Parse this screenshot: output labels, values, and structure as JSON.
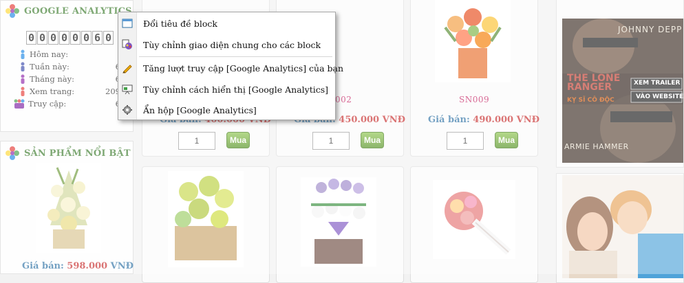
{
  "analytics": {
    "title": "GOOGLE ANALYTICS",
    "counter": [
      "0",
      "0",
      "0",
      "0",
      "0",
      "0",
      "6",
      "0"
    ],
    "stats": [
      {
        "label": "Hôm nay:",
        "value": ""
      },
      {
        "label": "Tuần này:",
        "value": "6"
      },
      {
        "label": "Tháng này:",
        "value": "6"
      },
      {
        "label": "Xem trang:",
        "value": "209"
      },
      {
        "label": "Truy cập:",
        "value": "6"
      }
    ]
  },
  "featured": {
    "title": "SẢN PHẨM NỔI BẬT",
    "price_label": "Giá bán:",
    "price": "598.000",
    "currency": "VNĐ"
  },
  "products_top": [
    {
      "code": "",
      "price_label": "Giá bán:",
      "price": "400.000 VNĐ",
      "qty": "1",
      "buy": "Mua"
    },
    {
      "code": "002",
      "price_label": "Giá bán:",
      "price": "450.000 VNĐ",
      "qty": "1",
      "buy": "Mua"
    },
    {
      "code": "SN009",
      "price_label": "Giá bán:",
      "price": "490.000 VNĐ",
      "qty": "1",
      "buy": "Mua"
    }
  ],
  "ad": {
    "name": "JOHNNY DEPP",
    "title1": "THE LONE",
    "title2": "RANGER",
    "subtitle": "KỴ SĨ CÔ ĐỘC",
    "trailer_btn": "XEM TRAILER",
    "website_btn": "VÀO WEBSITE",
    "name2": "ARMIE HAMMER"
  },
  "context_menu": {
    "items": [
      {
        "label": "Đổi tiêu đề block",
        "icon": "window-icon"
      },
      {
        "label": "Tùy chỉnh giao diện chung cho các block",
        "icon": "palette-icon"
      },
      {
        "label": "Tăng lượt truy cập [Google Analytics] của bạn",
        "icon": "pencil-icon"
      },
      {
        "label": "Tùy chỉnh cách hiển thị [Google Analytics]",
        "icon": "presentation-icon"
      },
      {
        "label": "Ẩn hộp [Google Analytics]",
        "icon": "gear-icon"
      }
    ]
  },
  "colors": {
    "block_title": "#3a7a2a",
    "price_label": "#2a6fa3",
    "price_amount": "#c62828",
    "product_code": "#c2185b",
    "buy_button": "#4f8f1c"
  }
}
